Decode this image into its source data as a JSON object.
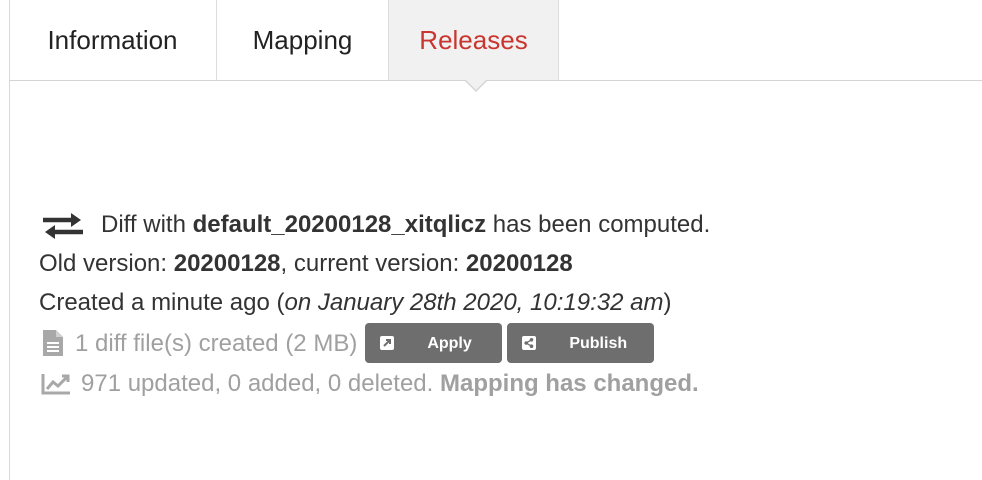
{
  "tabs": [
    {
      "label": "Information",
      "active": false
    },
    {
      "label": "Mapping",
      "active": false
    },
    {
      "label": "Releases",
      "active": true
    }
  ],
  "diff": {
    "prefix": "Diff with",
    "name": "default_20200128_xitqlicz",
    "suffix": "has been computed.",
    "icon": "exchange-arrows-icon"
  },
  "versions": {
    "old_label": "Old version:",
    "old_value": "20200128",
    "current_label": ", current version:",
    "current_value": "20200128"
  },
  "created": {
    "relative": "Created a minute ago (",
    "absolute": "on January 28th 2020, 10:19:32 am",
    "close": ")"
  },
  "files": {
    "text": "1 diff file(s) created (2 MB)",
    "icon": "file-icon",
    "apply_label": "Apply",
    "apply_icon": "external-link-icon",
    "publish_label": "Publish",
    "publish_icon": "share-icon"
  },
  "stats": {
    "text": "971 updated, 0 added, 0 deleted.",
    "warning": "Mapping has changed.",
    "icon": "chart-line-icon"
  },
  "colors": {
    "active_tab": "#c9362f",
    "button_bg": "#6e6e6e",
    "muted_text": "#a0a0a0"
  }
}
